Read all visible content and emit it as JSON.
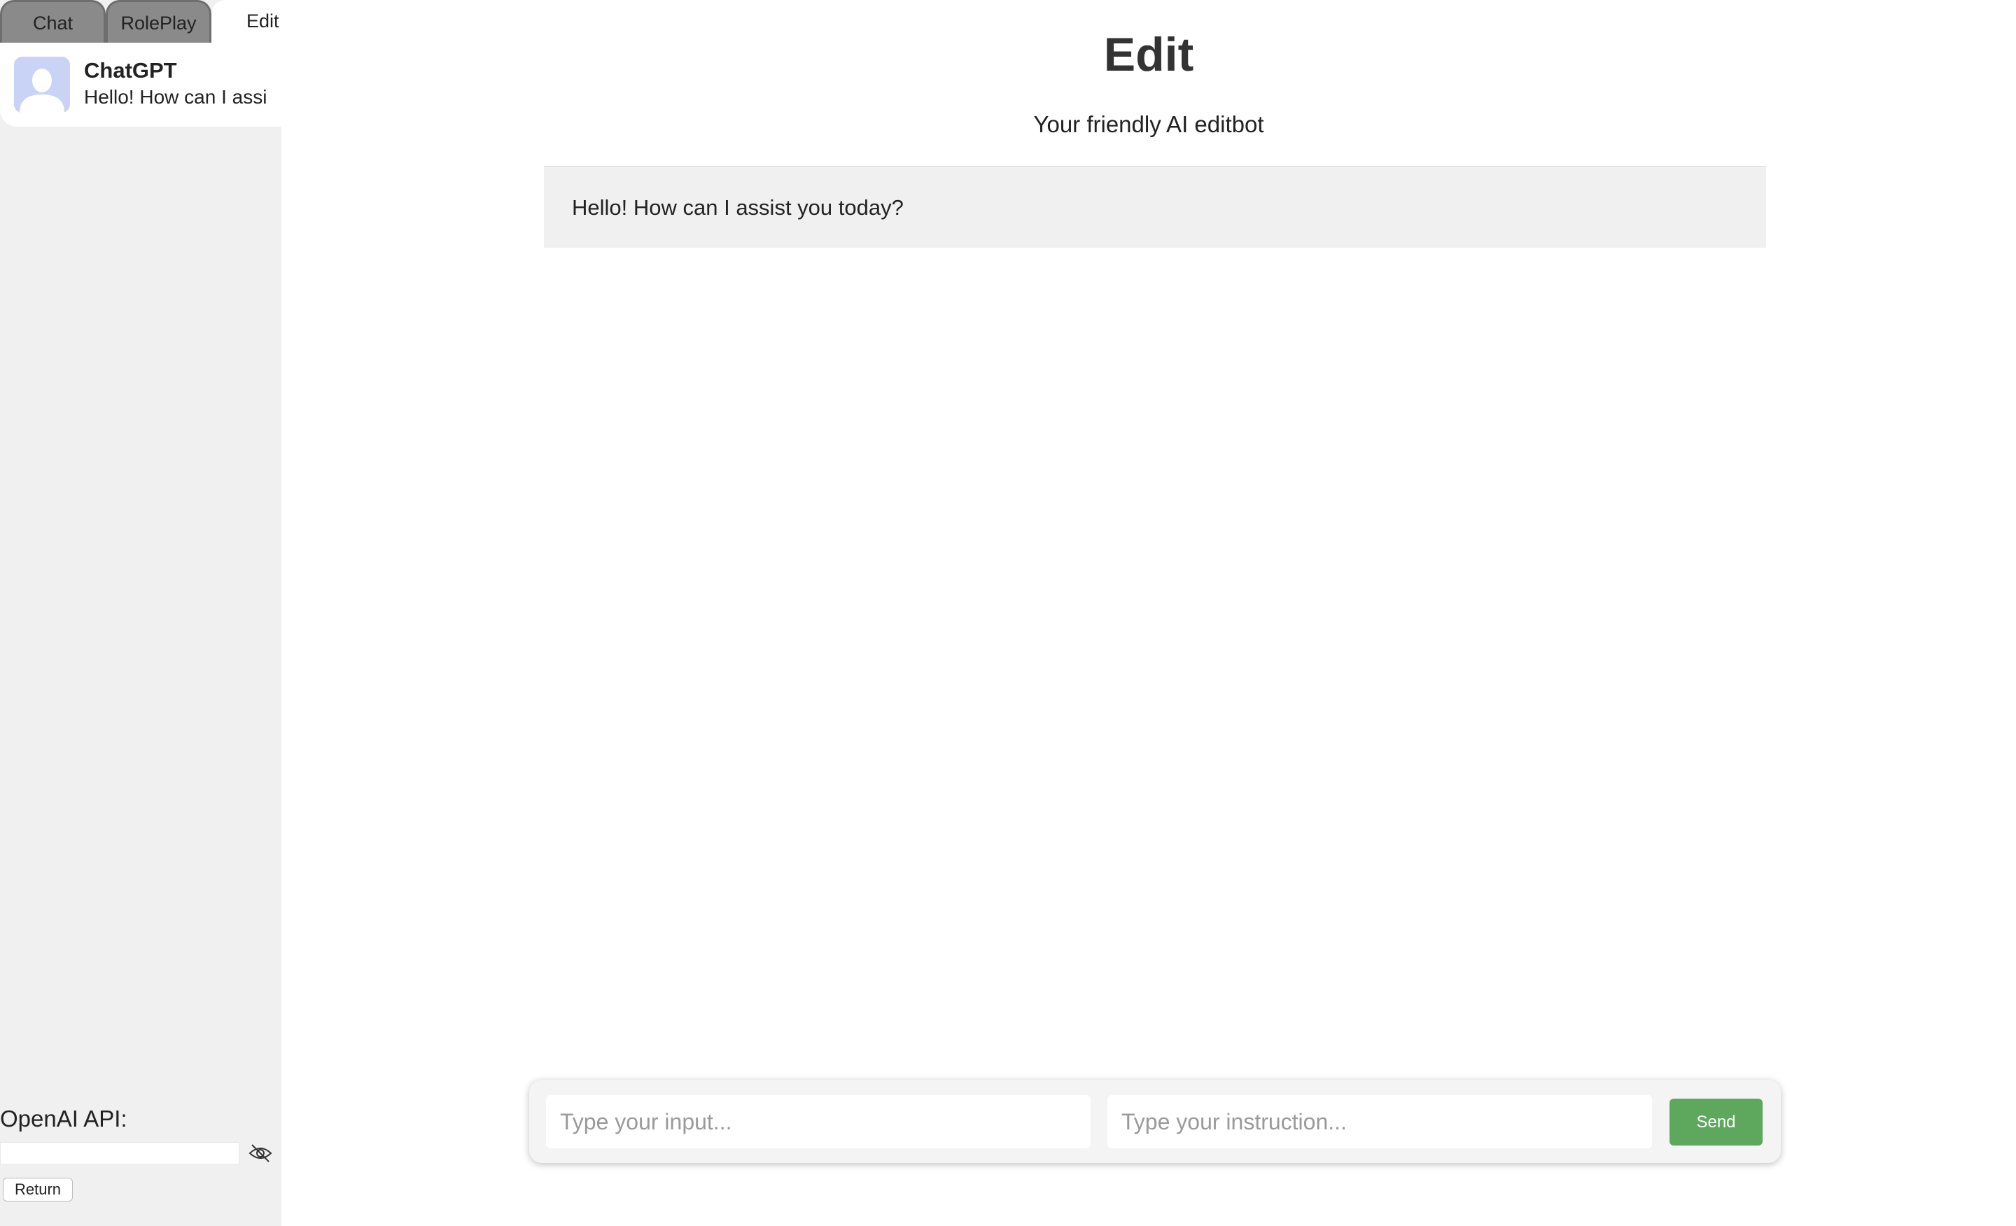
{
  "sidebar": {
    "tabs": [
      {
        "label": "Chat",
        "active": false
      },
      {
        "label": "RolePlay",
        "active": false
      },
      {
        "label": "Edit",
        "active": true
      }
    ],
    "conversation": {
      "name": "ChatGPT",
      "preview": "Hello! How can I assi",
      "avatar_icon": "user-silhouette-icon"
    },
    "api": {
      "label": "OpenAI API:",
      "value": "",
      "toggle_icon": "eye-off-icon"
    },
    "return_label": "Return"
  },
  "main": {
    "title": "Edit",
    "subtitle": "Your friendly AI editbot",
    "messages": [
      {
        "role": "assistant",
        "text": "Hello! How can I assist you today?"
      }
    ]
  },
  "composer": {
    "input_placeholder": "Type your input...",
    "instruction_placeholder": "Type your instruction...",
    "send_label": "Send"
  },
  "colors": {
    "sidebar_bg": "#f0f0f0",
    "tab_inactive": "#8a8a8a",
    "message_bg": "#f0f0f0",
    "send_button": "#5ea85e",
    "avatar_bg": "#c9d3f5"
  }
}
